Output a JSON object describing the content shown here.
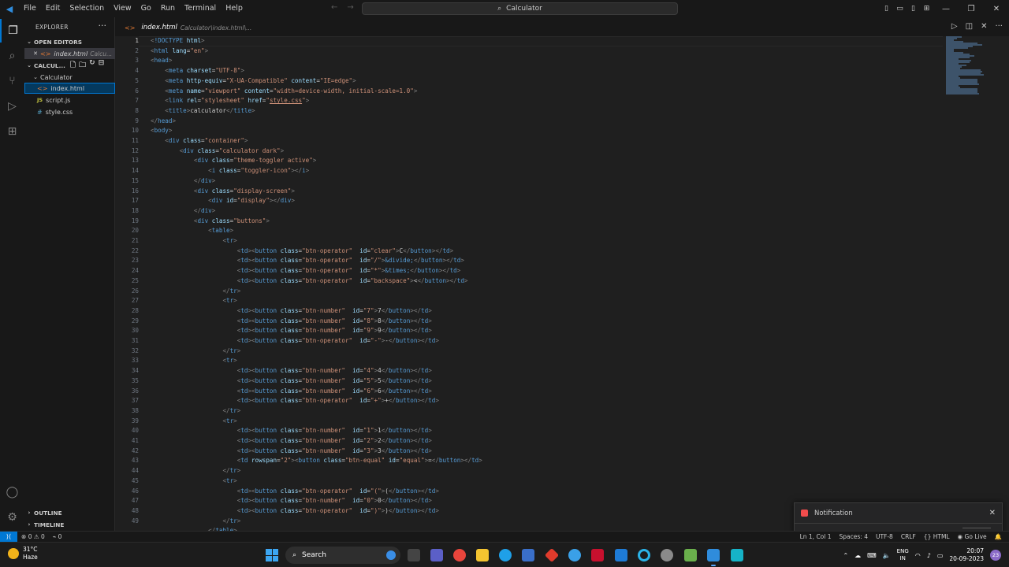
{
  "titlebar": {
    "menu": [
      "File",
      "Edit",
      "Selection",
      "View",
      "Go",
      "Run",
      "Terminal",
      "Help"
    ],
    "search_text": "Calculator"
  },
  "sidebar": {
    "title": "EXPLORER",
    "open_editors_label": "OPEN EDITORS",
    "open_file_name": "index.html",
    "open_file_path": "Calcu...",
    "folder_section_label": "CALCUL...",
    "folder_name": "Calculator",
    "files": [
      "index.html",
      "script.js",
      "style.css"
    ],
    "outline_label": "OUTLINE",
    "timeline_label": "TIMELINE"
  },
  "tab": {
    "name": "index.html",
    "path": "Calculator\\index.html\\..."
  },
  "editor": {
    "current_line": 1,
    "line_count": 49
  },
  "notification": {
    "title": "Notification"
  },
  "statusbar": {
    "errors": "0",
    "warnings": "0",
    "ports": "0",
    "position": "Ln 1, Col 1",
    "spaces": "Spaces: 4",
    "encoding": "UTF-8",
    "eol": "CRLF",
    "language": "HTML",
    "golive": "Go Live"
  },
  "taskbar": {
    "temperature": "31°C",
    "weather": "Haze",
    "search_label": "Search",
    "lang_top": "ENG",
    "lang_bottom": "IN",
    "time": "20:07",
    "date": "20-09-2023",
    "badge": "23"
  },
  "colors": {
    "accent": "#0078d4",
    "tag": "#569cd6",
    "attr": "#9cdcfe",
    "string": "#ce9178"
  }
}
